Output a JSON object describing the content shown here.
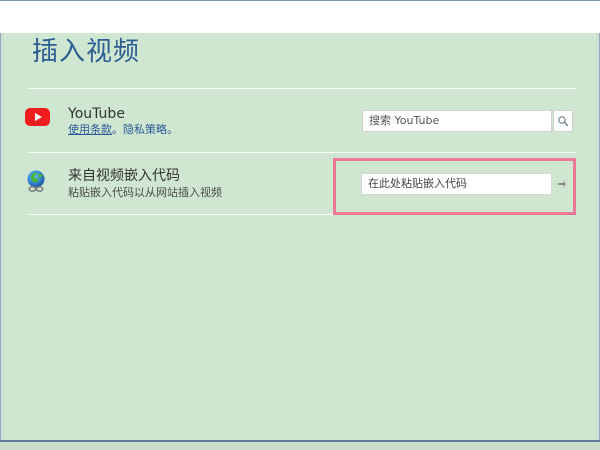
{
  "dialog": {
    "title": "插入视频"
  },
  "services": [
    {
      "icon": "youtube-icon",
      "title": "YouTube",
      "links": {
        "terms": "使用条款",
        "period1": "。",
        "privacy": "隐私策略",
        "period2": "。"
      },
      "search": {
        "text": "搜索 YouTube"
      }
    },
    {
      "icon": "globe-link-icon",
      "title": "来自视频嵌入代码",
      "subtitle": "粘贴嵌入代码以从网站插入视频",
      "input": {
        "text": "在此处粘贴嵌入代码"
      }
    }
  ],
  "colors": {
    "background": "#cfe7d0",
    "title": "#2c5d93",
    "highlight": "#ef7a95",
    "youtube": "#ef1d1d"
  }
}
